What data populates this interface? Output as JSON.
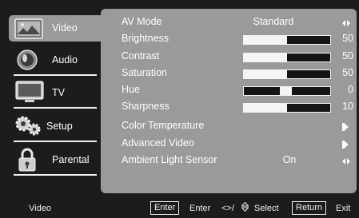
{
  "sidebar": {
    "items": [
      {
        "label": "Video",
        "icon": "picture-icon",
        "active": true
      },
      {
        "label": "Audio",
        "icon": "speaker-icon",
        "active": false
      },
      {
        "label": "TV",
        "icon": "tv-icon",
        "active": false
      },
      {
        "label": "Setup",
        "icon": "gears-icon",
        "active": false
      },
      {
        "label": "Parental",
        "icon": "padlock-icon",
        "active": false
      }
    ]
  },
  "menu": {
    "av_mode": {
      "label": "AV Mode",
      "value": "Standard"
    },
    "brightness": {
      "label": "Brightness",
      "value": "50",
      "level": 0.5
    },
    "contrast": {
      "label": "Contrast",
      "value": "50",
      "level": 0.5
    },
    "saturation": {
      "label": "Saturation",
      "value": "50",
      "level": 0.5
    },
    "hue": {
      "label": "Hue",
      "value": "0",
      "level": 0.5
    },
    "sharpness": {
      "label": "Sharpness",
      "value": "10",
      "level": 0.5
    },
    "color_temperature": {
      "label": "Color Temperature"
    },
    "advanced_video": {
      "label": "Advanced Video"
    },
    "ambient_light_sensor": {
      "label": "Ambient Light Sensor",
      "value": "On"
    }
  },
  "footer": {
    "context": "Video",
    "enter_key": "Enter",
    "enter_label": "Enter",
    "nav_symbols": "<>/",
    "select_label": "Select",
    "return_key": "Return",
    "exit_label": "Exit"
  },
  "colors": {
    "background": "#1c1c1c",
    "panel": "#9a9a9a",
    "text": "#ffffff"
  }
}
